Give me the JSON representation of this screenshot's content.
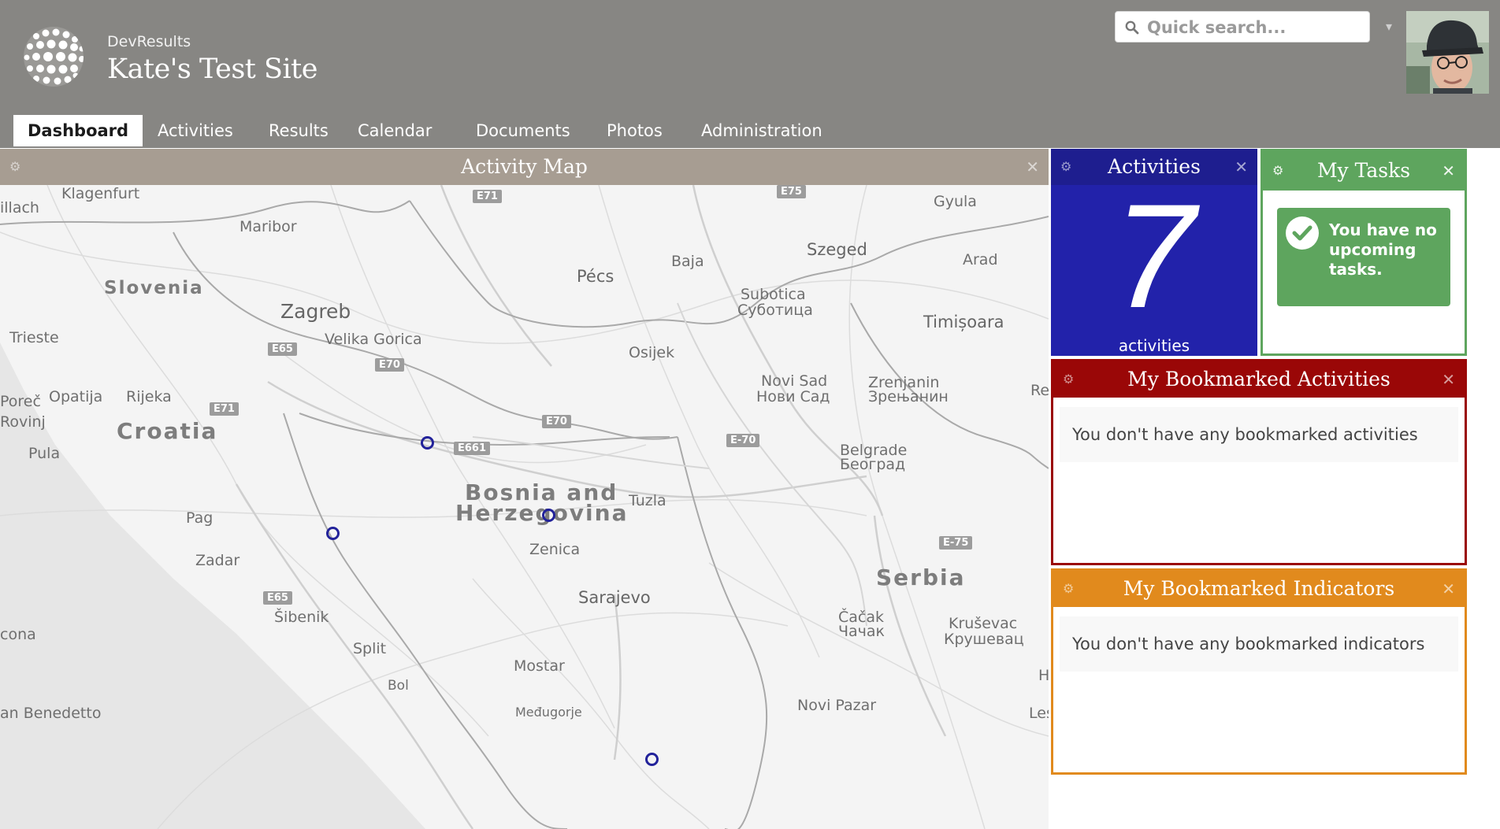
{
  "header": {
    "org_name": "DevResults",
    "site_title": "Kate's Test Site",
    "search_placeholder": "Quick search...",
    "user_menu_caret": "▾",
    "colors": {
      "header_bg": "#878683"
    }
  },
  "nav": {
    "tabs": [
      {
        "label": "Dashboard",
        "active": true
      },
      {
        "label": "Activities",
        "active": false
      },
      {
        "label": "Results",
        "active": false
      },
      {
        "label": "Calendar",
        "active": false
      },
      {
        "label": "Documents",
        "active": false
      },
      {
        "label": "Photos",
        "active": false
      },
      {
        "label": "Administration",
        "active": false
      }
    ]
  },
  "widgets": {
    "map": {
      "title": "Activity Map",
      "labels": {
        "klagenfurt": "Klagenfurt",
        "villach": "illach",
        "maribor": "Maribor",
        "slovenia": "Slovenia",
        "zagreb": "Zagreb",
        "velika_gorica": "Velika Gorica",
        "trieste": "Trieste",
        "porec": "Poreč",
        "opatija": "Opatija",
        "rijeka": "Rijeka",
        "rovinj": "Rovinj",
        "croatia": "Croatia",
        "pula": "Pula",
        "pag": "Pag",
        "zadar": "Zadar",
        "sibenik": "Šibenik",
        "split": "Split",
        "ancona": "cona",
        "bol": "Bol",
        "san_benedetto": "an Benedetto",
        "pecs": "Pécs",
        "baja": "Baja",
        "szeged": "Szeged",
        "gyula": "Gyula",
        "arad": "Arad",
        "subotica": "Subotica",
        "subotica_cyr": "Суботица",
        "osijek": "Osijek",
        "timisoara": "Timișoara",
        "novi_sad": "Novi Sad",
        "novi_sad_cyr": "Нови Сад",
        "zrenjanin": "Zrenjanin",
        "zrenjanin_cyr": "Зрењанин",
        "re": "Re",
        "belgrade": "Belgrade",
        "belgrade_cyr": "Београд",
        "bosnia_1": "Bosnia and",
        "bosnia_2": "Herzegovina",
        "tuzla": "Tuzla",
        "zenica": "Zenica",
        "sarajevo": "Sarajevo",
        "serbia": "Serbia",
        "cacak": "Čačak",
        "cacak_cyr": "Чачак",
        "krusevac": "Kruševac",
        "krusevac_cyr": "Крушевац",
        "mostar": "Mostar",
        "medugorje": "Međugorje",
        "novi_pazar": "Novi Pazar",
        "les": "Les",
        "h": "H"
      },
      "highways": {
        "e71_top": "E71",
        "e75_top": "E75",
        "e65_a": "E65",
        "e70_a": "E70",
        "e71_b": "E71",
        "e70_b": "E70",
        "e661": "E661",
        "e70_c": "E-70",
        "e75_b": "E-75",
        "e65_b": "E65"
      },
      "marker_count": 4,
      "marker_color": "#22229a"
    },
    "activities": {
      "title": "Activities",
      "count": "7",
      "unit": "activities",
      "color": "#2222aa"
    },
    "tasks": {
      "title": "My Tasks",
      "message": "You have no upcoming tasks.",
      "color": "#5ea55e"
    },
    "bookmarked_activities": {
      "title": "My Bookmarked Activities",
      "message": "You don't have any bookmarked activities",
      "color": "#9a0707"
    },
    "bookmarked_indicators": {
      "title": "My Bookmarked Indicators",
      "message": "You don't have any bookmarked indicators",
      "color": "#e18a1d"
    }
  }
}
